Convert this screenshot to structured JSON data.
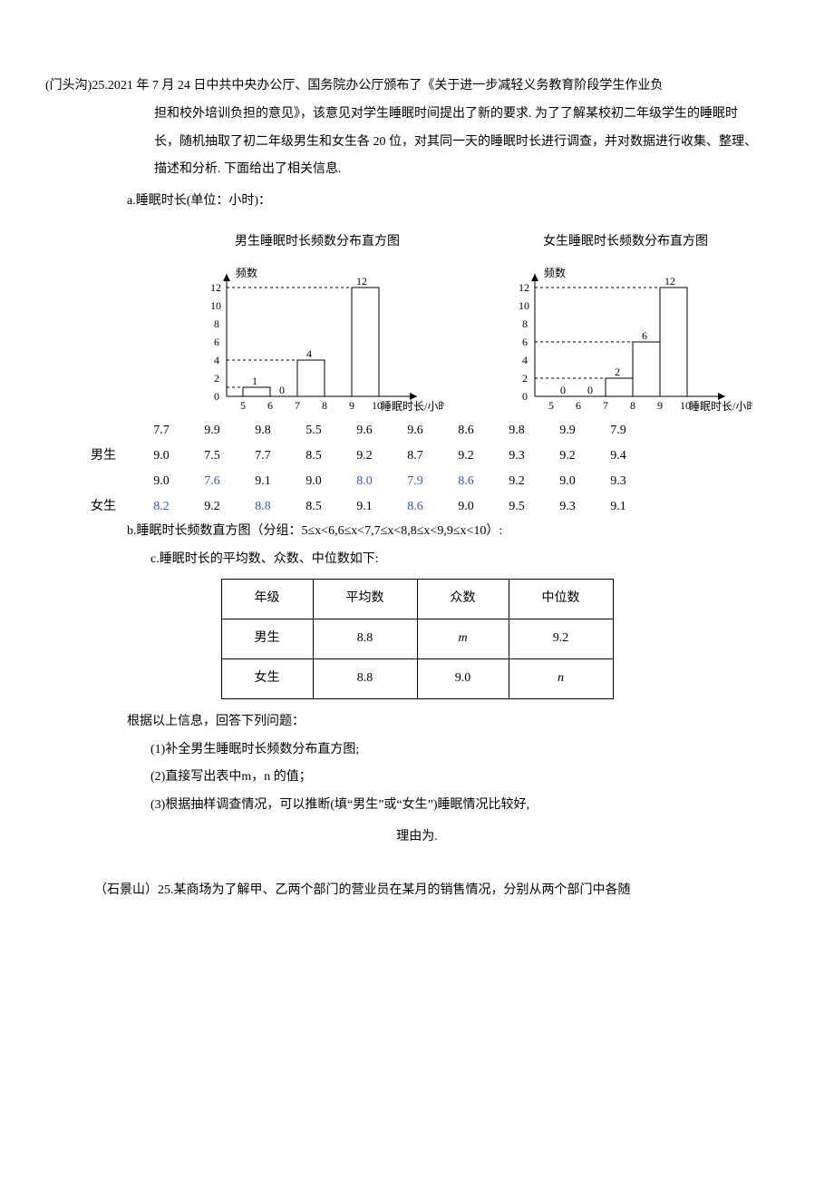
{
  "q1": {
    "prefix": "(门头沟)25.",
    "para1_l1": "2021 年 7 月 24 日中共中央办公厅、国务院办公厅颁布了《关于进一步减轻义务教育阶段学生作业负",
    "para1_l2": "担和校外培训负担的意见》，该意见对学生睡眠时间提出了新的要求. 为了了解某校初二年级学生的睡眠时",
    "para1_l3": "长，随机抽取了初二年级男生和女生各 20 位，对其同一天的睡眠时长进行调查，并对数据进行收集、整理、",
    "para1_l4": "描述和分析. 下面给出了相关信息.",
    "section_a": "a.睡眠时长(单位：小时)：",
    "chart_label_freq": "频数",
    "chart_label_xaxis": "睡眠时长/小时",
    "chart_title_boys": "男生睡眠时长频数分布直方图",
    "chart_title_girls": "女生睡眠时长频数分布直方图",
    "data_rows": {
      "boys_label": "男生",
      "girls_label": "女生",
      "r1": [
        "7.7",
        "9.9",
        "9.8",
        "5.5",
        "9.6",
        "9.6",
        "8.6",
        "9.8",
        "9.9",
        "7.9"
      ],
      "r2": [
        "9.0",
        "7.5",
        "7.7",
        "8.5",
        "9.2",
        "8.7",
        "9.2",
        "9.3",
        "9.2",
        "9.4"
      ],
      "r3": [
        "9.0",
        "7.6",
        "9.1",
        "9.0",
        "8.0",
        "7.9",
        "8.6",
        "9.2",
        "9.0",
        "9.3"
      ],
      "r4": [
        "8.2",
        "9.2",
        "8.8",
        "8.5",
        "9.1",
        "8.6",
        "9.0",
        "9.5",
        "9.3",
        "9.1"
      ],
      "r3_blue_idx": [
        1,
        4,
        5,
        6
      ],
      "r4_blue_idx": [
        0,
        2,
        5
      ]
    },
    "note_b": "b.睡眠时长频数直方图（分组：5≤x<6,6≤x<7,7≤x<8,8≤x<9,9≤x<10）:",
    "note_c": "c.睡眠时长的平均数、众数、中位数如下:",
    "table": {
      "h1": "年级",
      "h2": "平均数",
      "h3": "众数",
      "h4": "中位数",
      "r1c1": "男生",
      "r1c2": "8.8",
      "r1c3": "m",
      "r1c4": "9.2",
      "r2c1": "女生",
      "r2c2": "8.8",
      "r2c3": "9.0",
      "r2c4": "n"
    },
    "followup": "根据以上信息，回答下列问题：",
    "sub1": "(1)补全男生睡眠时长频数分布直方图;",
    "sub2": "(2)直接写出表中m，n 的值；",
    "sub3": "(3)根据抽样调查情况，可以推断(填“男生”或“女生”)睡眠情况比较好,",
    "reason": "理由为."
  },
  "q2": {
    "text": "（石景山）25.某商场为了解甲、乙两个部门的营业员在某月的销售情况，分别从两个部门中各随"
  },
  "chart_data": [
    {
      "type": "bar",
      "title": "男生睡眠时长频数分布直方图",
      "xlabel": "睡眠时长/小时",
      "ylabel": "频数",
      "bin_edges": [
        5,
        6,
        7,
        8,
        9,
        10
      ],
      "values": [
        1,
        0,
        4,
        null,
        12
      ],
      "y_ticks": [
        0,
        2,
        4,
        6,
        8,
        10,
        12
      ],
      "ylim": [
        0,
        12
      ],
      "note": "8≤x<9 bar missing (to be completed by student)"
    },
    {
      "type": "bar",
      "title": "女生睡眠时长频数分布直方图",
      "xlabel": "睡眠时长/小时",
      "ylabel": "频数",
      "bin_edges": [
        5,
        6,
        7,
        8,
        9,
        10
      ],
      "values": [
        0,
        0,
        2,
        6,
        12
      ],
      "y_ticks": [
        0,
        2,
        4,
        6,
        8,
        10,
        12
      ],
      "ylim": [
        0,
        12
      ]
    }
  ]
}
